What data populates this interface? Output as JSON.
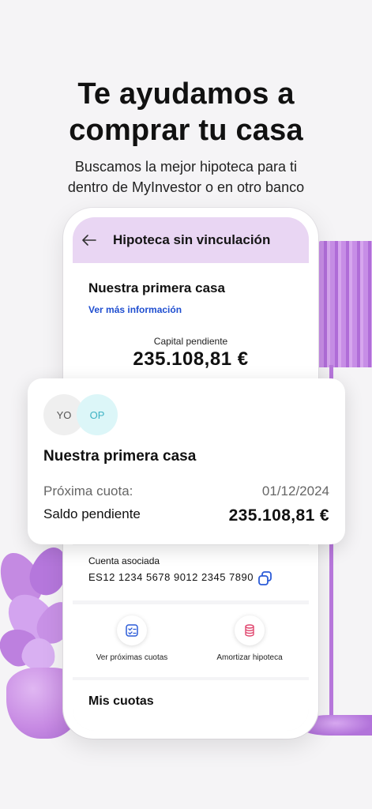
{
  "hero": {
    "title_line1": "Te ayudamos a",
    "title_line2": "comprar tu casa",
    "subtitle_line1": "Buscamos la mejor hipoteca para ti",
    "subtitle_line2": "dentro de MyInvestor o en otro banco"
  },
  "app": {
    "header_title": "Hipoteca sin vinculación",
    "back_icon": "arrow-left-icon",
    "summary": {
      "name": "Nuestra primera casa",
      "link": "Ver más información",
      "capital_label": "Capital pendiente",
      "capital_value": "235.108,81 €"
    },
    "account": {
      "label": "Cuenta asociada",
      "iban": "ES12 1234 5678 9012 2345 7890",
      "copy_icon": "copy-icon"
    },
    "actions": [
      {
        "label": "Ver próximas cuotas",
        "icon": "checklist-icon"
      },
      {
        "label": "Amortizar hipoteca",
        "icon": "coins-icon"
      }
    ],
    "section_title": "Mis cuotas"
  },
  "card": {
    "avatars": [
      "YO",
      "OP"
    ],
    "title": "Nuestra primera casa",
    "next_label": "Próxima cuota:",
    "next_value": "01/12/2024",
    "balance_label": "Saldo pendiente",
    "balance_value": "235.108,81 €"
  },
  "colors": {
    "header_bg": "#e9d6f3",
    "link": "#1f4ed0",
    "accent_purple": "#b978dd",
    "action_icon_blue": "#2b5bd7",
    "action_icon_pink": "#e0476f"
  }
}
